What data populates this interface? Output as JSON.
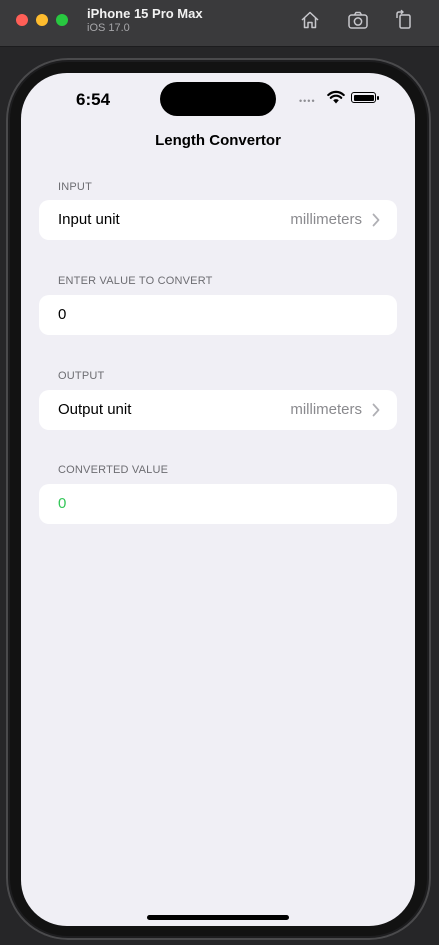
{
  "simulator": {
    "device_name": "iPhone 15 Pro Max",
    "os_version": "iOS 17.0",
    "icons": [
      "home-icon",
      "camera-icon",
      "rotate-icon"
    ]
  },
  "status_bar": {
    "time": "6:54",
    "signal": "••••"
  },
  "nav": {
    "title": "Length Convertor"
  },
  "sections": {
    "input": {
      "header": "INPUT",
      "row_label": "Input unit",
      "row_value": "millimeters"
    },
    "enter_value": {
      "header": "ENTER VALUE TO CONVERT",
      "value": "0"
    },
    "output": {
      "header": "OUTPUT",
      "row_label": "Output unit",
      "row_value": "millimeters"
    },
    "converted": {
      "header": "CONVERTED VALUE",
      "value": "0"
    }
  },
  "colors": {
    "background": "#f0eff5",
    "accent_green": "#34c759",
    "secondary_text": "#8a8a8e"
  }
}
